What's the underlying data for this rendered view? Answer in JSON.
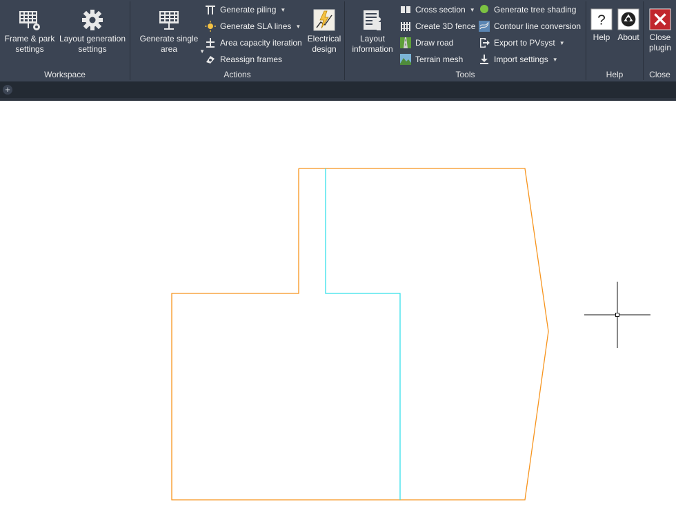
{
  "ribbon": {
    "workspace": {
      "title": "Workspace",
      "frame_park": "Frame & park\nsettings",
      "layout_gen": "Layout generation\nsettings"
    },
    "actions": {
      "title": "Actions",
      "generate_single": "Generate single\narea",
      "generate_piling": "Generate piling",
      "generate_sla": "Generate SLA lines",
      "area_capacity": "Area capacity iteration",
      "reassign_frames": "Reassign frames",
      "electrical": "Electrical\ndesign"
    },
    "tools": {
      "title": "Tools",
      "layout_info": "Layout\ninformation",
      "cross_section": "Cross section",
      "fence": "Create 3D fence",
      "draw_road": "Draw road",
      "terrain_mesh": "Terrain mesh",
      "tree_shading": "Generate tree shading",
      "contour": "Contour line conversion",
      "export_pvsyst": "Export to PVsyst",
      "import_settings": "Import settings"
    },
    "help": {
      "title": "Help",
      "help_label": "Help",
      "about_label": "About"
    },
    "close": {
      "title": "Close",
      "close_label": "Close\nplugin"
    }
  },
  "tabbar": {
    "add_symbol": "+"
  },
  "colors": {
    "ribbon_bg": "#3b4453",
    "boundary": "#f7941d",
    "divider": "#35e0ea",
    "close_red": "#c1272d"
  }
}
